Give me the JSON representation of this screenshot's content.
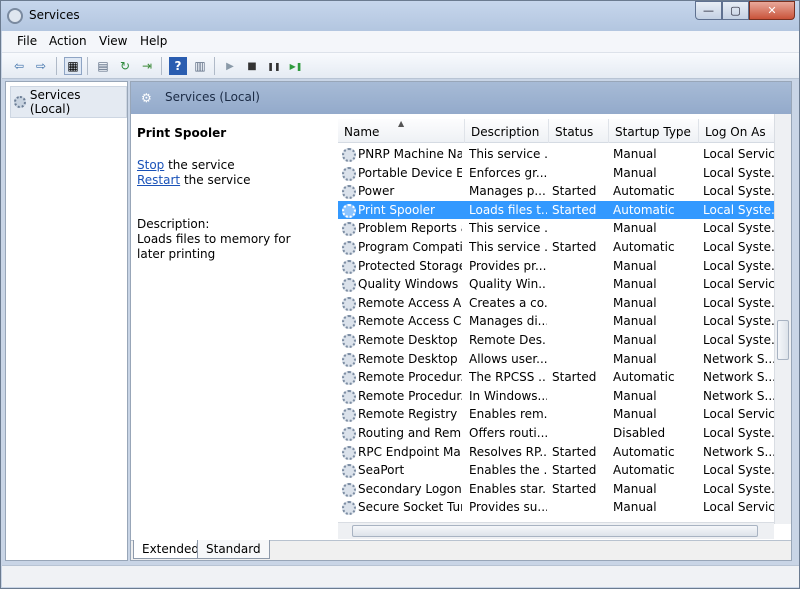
{
  "window": {
    "title": "Services",
    "minimize": "—",
    "maximize": "▢",
    "close": "✕"
  },
  "menu": [
    "File",
    "Action",
    "View",
    "Help"
  ],
  "toolbar": {
    "back": "⇦",
    "forward": "⇨",
    "up": "▦",
    "properties": "▤",
    "refresh": "↻",
    "export": "⇥",
    "help": "?",
    "view": "▥",
    "start": "▶",
    "stop": "■",
    "pause": "❚❚",
    "restart": "▶❚"
  },
  "tree": {
    "root_label": "Services (Local)"
  },
  "header": {
    "title": "Services (Local)"
  },
  "description": {
    "service_name": "Print Spooler",
    "stop_link": "Stop",
    "stop_suffix": " the service",
    "restart_link": "Restart",
    "restart_suffix": " the service",
    "label": "Description:",
    "text": "Loads files to memory for later printing"
  },
  "columns": [
    "Name",
    "Description",
    "Status",
    "Startup Type",
    "Log On As"
  ],
  "rows": [
    [
      "PNRP Machine Na...",
      "This service ...",
      "",
      "Manual",
      "Local Service"
    ],
    [
      "Portable Device E...",
      "Enforces gr...",
      "",
      "Manual",
      "Local Syste..."
    ],
    [
      "Power",
      "Manages p...",
      "Started",
      "Automatic",
      "Local Syste..."
    ],
    [
      "Print Spooler",
      "Loads files t...",
      "Started",
      "Automatic",
      "Local Syste..."
    ],
    [
      "Problem Reports a...",
      "This service ...",
      "",
      "Manual",
      "Local Syste..."
    ],
    [
      "Program Compati...",
      "This service ...",
      "Started",
      "Automatic",
      "Local Syste..."
    ],
    [
      "Protected Storage",
      "Provides pr...",
      "",
      "Manual",
      "Local Syste..."
    ],
    [
      "Quality Windows ...",
      "Quality Win...",
      "",
      "Manual",
      "Local Service"
    ],
    [
      "Remote Access A...",
      "Creates a co...",
      "",
      "Manual",
      "Local Syste..."
    ],
    [
      "Remote Access C...",
      "Manages di...",
      "",
      "Manual",
      "Local Syste..."
    ],
    [
      "Remote Desktop ...",
      "Remote Des...",
      "",
      "Manual",
      "Local Syste..."
    ],
    [
      "Remote Desktop S...",
      "Allows user...",
      "",
      "Manual",
      "Network S..."
    ],
    [
      "Remote Procedur...",
      "The RPCSS ...",
      "Started",
      "Automatic",
      "Network S..."
    ],
    [
      "Remote Procedur...",
      "In Windows...",
      "",
      "Manual",
      "Network S..."
    ],
    [
      "Remote Registry",
      "Enables rem...",
      "",
      "Manual",
      "Local Service"
    ],
    [
      "Routing and Rem...",
      "Offers routi...",
      "",
      "Disabled",
      "Local Syste..."
    ],
    [
      "RPC Endpoint Ma...",
      "Resolves RP...",
      "Started",
      "Automatic",
      "Network S..."
    ],
    [
      "SeaPort",
      "Enables the ...",
      "Started",
      "Automatic",
      "Local Syste..."
    ],
    [
      "Secondary Logon",
      "Enables star...",
      "Started",
      "Manual",
      "Local Syste..."
    ],
    [
      "Secure Socket Tun...",
      "Provides su...",
      "",
      "Manual",
      "Local Service"
    ]
  ],
  "selected_row": 3,
  "tabs": [
    "Extended",
    "Standard"
  ],
  "colors": {
    "selection": "#3399ff",
    "header_band": "#9fb4d2",
    "link": "#1a52b8"
  }
}
